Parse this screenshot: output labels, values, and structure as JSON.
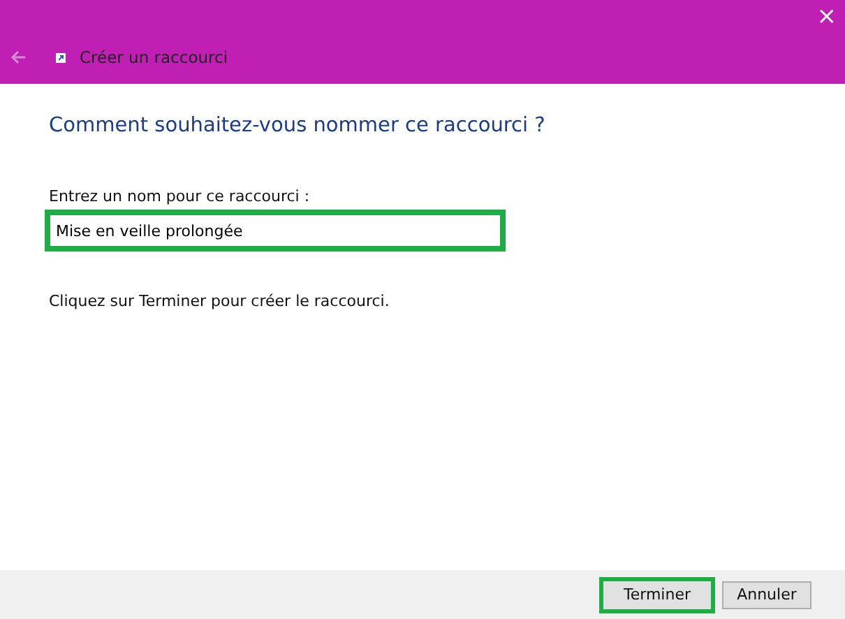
{
  "window": {
    "title": "Créer un raccourci",
    "close": "×"
  },
  "heading": "Comment souhaitez-vous nommer ce raccourci ?",
  "name_field": {
    "label": "Entrez un nom pour ce raccourci :",
    "value": "Mise en veille prolongée",
    "highlighted": true
  },
  "instruction": "Cliquez sur Terminer pour créer le raccourci.",
  "buttons": [
    {
      "label": "Terminer",
      "highlighted": true
    },
    {
      "label": "Annuler",
      "highlighted": false
    }
  ]
}
